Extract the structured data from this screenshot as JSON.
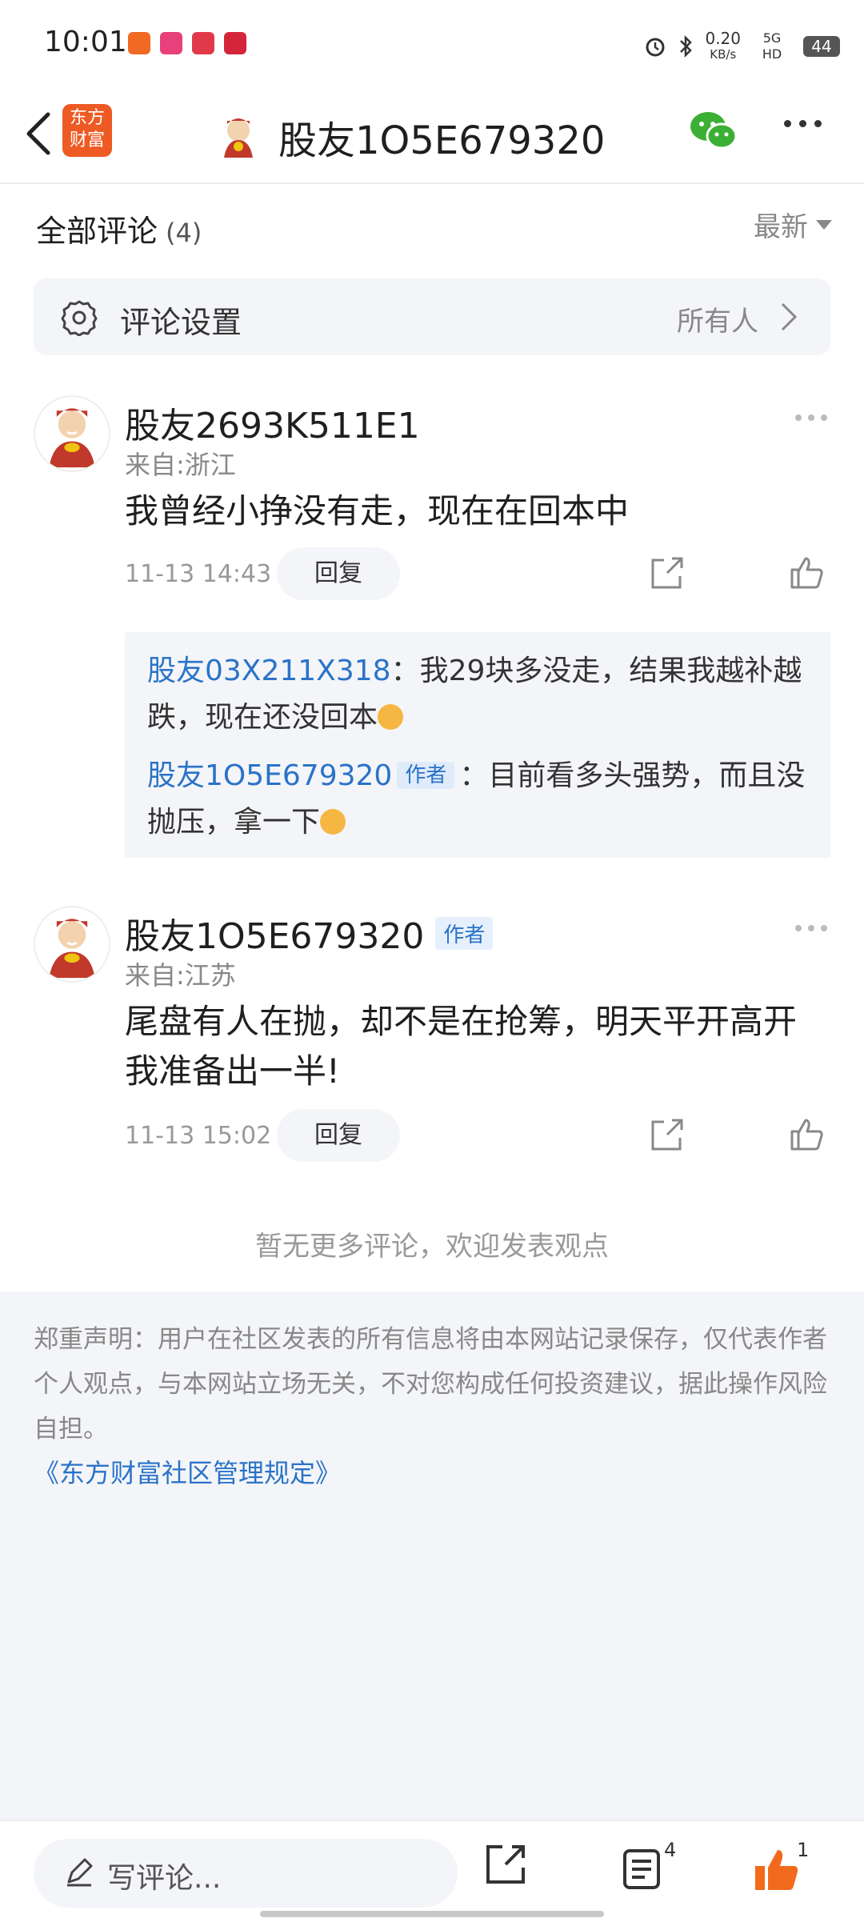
{
  "status_bar": {
    "time": "10:01",
    "net_speed": "0.20",
    "net_unit": "KB/s",
    "network": "5G HD",
    "battery": "44"
  },
  "header": {
    "brand_logo_text": "东方财富",
    "title": "股友1O5E679320"
  },
  "comments_section": {
    "title": "全部评论",
    "count": "(4)",
    "sort_label": "最新"
  },
  "settings_row": {
    "label": "评论设置",
    "value": "所有人"
  },
  "comments": [
    {
      "username": "股友2693K511E1",
      "location": "来自:浙江",
      "text": "我曾经小挣没有走，现在在回本中",
      "time": "11-13 14:43",
      "reply_label": "回复",
      "replies": [
        {
          "username": "股友03X211X318",
          "text": "：我29块多没走，结果我越补越跌，现在还没回本"
        },
        {
          "username": "股友1O5E679320",
          "tag": "作者",
          "text": "：目前看多头强势，而且没抛压，拿一下"
        }
      ]
    },
    {
      "username": "股友1O5E679320",
      "tag": "作者",
      "location": "来自:江苏",
      "text": "尾盘有人在抛，却不是在抢筹，明天平开高开我准备出一半!",
      "time": "11-13 15:02",
      "reply_label": "回复"
    }
  ],
  "no_more_text": "暂无更多评论，欢迎发表观点",
  "footer": {
    "disclaimer": "郑重声明：用户在社区发表的所有信息将由本网站记录保存，仅代表作者个人观点，与本网站立场无关，不对您构成任何投资建议，据此操作风险自担。",
    "rules_link": "《东方财富社区管理规定》"
  },
  "bottom_bar": {
    "placeholder": "写评论...",
    "comment_count": "4",
    "like_count": "1"
  },
  "colors": {
    "brand_orange": "#ee5a24",
    "link_blue": "#2a73c9",
    "like_orange": "#f26b1d",
    "wechat_green": "#3cb034"
  }
}
